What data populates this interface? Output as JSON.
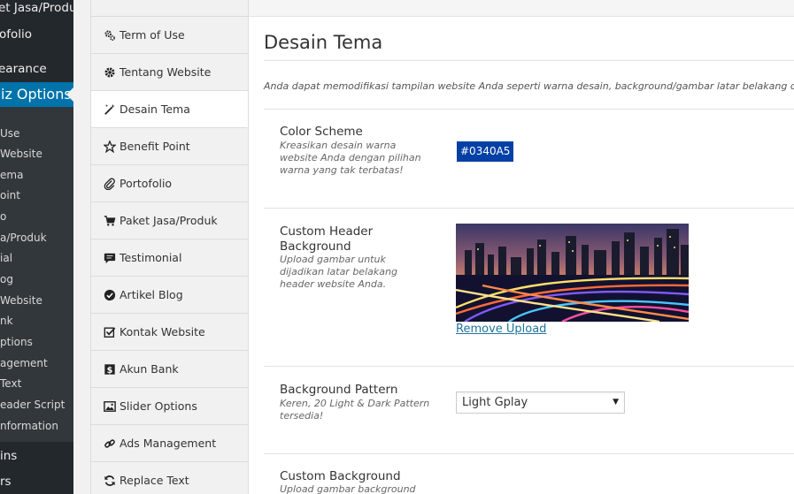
{
  "wp_menu": {
    "items": [
      {
        "label": "et Jasa/Produk",
        "size": "big"
      },
      {
        "label": "ofolio",
        "size": "big"
      },
      {
        "label": "earance",
        "size": "big"
      },
      {
        "label": "iz Options",
        "size": "active"
      },
      {
        "label": "Use",
        "size": "small"
      },
      {
        "label": "Website",
        "size": "small"
      },
      {
        "label": "ema",
        "size": "small"
      },
      {
        "label": "oint",
        "size": "small"
      },
      {
        "label": "o",
        "size": "small"
      },
      {
        "label": "a/Produk",
        "size": "small"
      },
      {
        "label": "ial",
        "size": "small"
      },
      {
        "label": "og",
        "size": "small"
      },
      {
        "label": "Website",
        "size": "small"
      },
      {
        "label": "nk",
        "size": "small"
      },
      {
        "label": "ptions",
        "size": "small"
      },
      {
        "label": "agement",
        "size": "small"
      },
      {
        "label": "Text",
        "size": "small"
      },
      {
        "label": "eader Script",
        "size": "small"
      },
      {
        "label": "nformation",
        "size": "small"
      },
      {
        "label": "ins",
        "size": "big"
      },
      {
        "label": "rs",
        "size": "big"
      }
    ]
  },
  "tabs": [
    {
      "label": "Term of Use",
      "icon": "gears-icon"
    },
    {
      "label": "Tentang Website",
      "icon": "gear-icon"
    },
    {
      "label": "Desain Tema",
      "icon": "magic-wand-icon",
      "active": true
    },
    {
      "label": "Benefit Point",
      "icon": "star-icon"
    },
    {
      "label": "Portofolio",
      "icon": "paperclip-icon"
    },
    {
      "label": "Paket Jasa/Produk",
      "icon": "cart-icon"
    },
    {
      "label": "Testimonial",
      "icon": "comment-icon"
    },
    {
      "label": "Artikel Blog",
      "icon": "check-circle-icon"
    },
    {
      "label": "Kontak Website",
      "icon": "check-square-icon"
    },
    {
      "label": "Akun Bank",
      "icon": "dollar-icon"
    },
    {
      "label": "Slider Options",
      "icon": "image-icon"
    },
    {
      "label": "Ads Management",
      "icon": "link-icon"
    },
    {
      "label": "Replace Text",
      "icon": "refresh-icon"
    }
  ],
  "main": {
    "title": "Desain Tema",
    "description": "Anda dapat memodifikasi tampilan website Anda seperti warna desain, background/gambar latar belakang dll.",
    "options": {
      "color_scheme": {
        "title": "Color Scheme",
        "desc": "Kreasikan desain warna website Anda dengan pilihan warna yang tak terbatas!",
        "value": "#0340A5"
      },
      "custom_header": {
        "title": "Custom Header Background",
        "desc": "Upload gambar untuk dijadikan latar belakang header website Anda.",
        "remove_label": "Remove Upload"
      },
      "bg_pattern": {
        "title": "Background Pattern",
        "desc": "Keren, 20 Light & Dark Pattern tersedia!",
        "selected": "Light Gplay"
      },
      "custom_bg": {
        "title": "Custom Background",
        "desc": "Upload gambar background"
      }
    }
  },
  "colors": {
    "wp_sidebar": "#23282d",
    "wp_active": "#0073aa",
    "swatch": "#0340A5",
    "link": "#21759b"
  }
}
